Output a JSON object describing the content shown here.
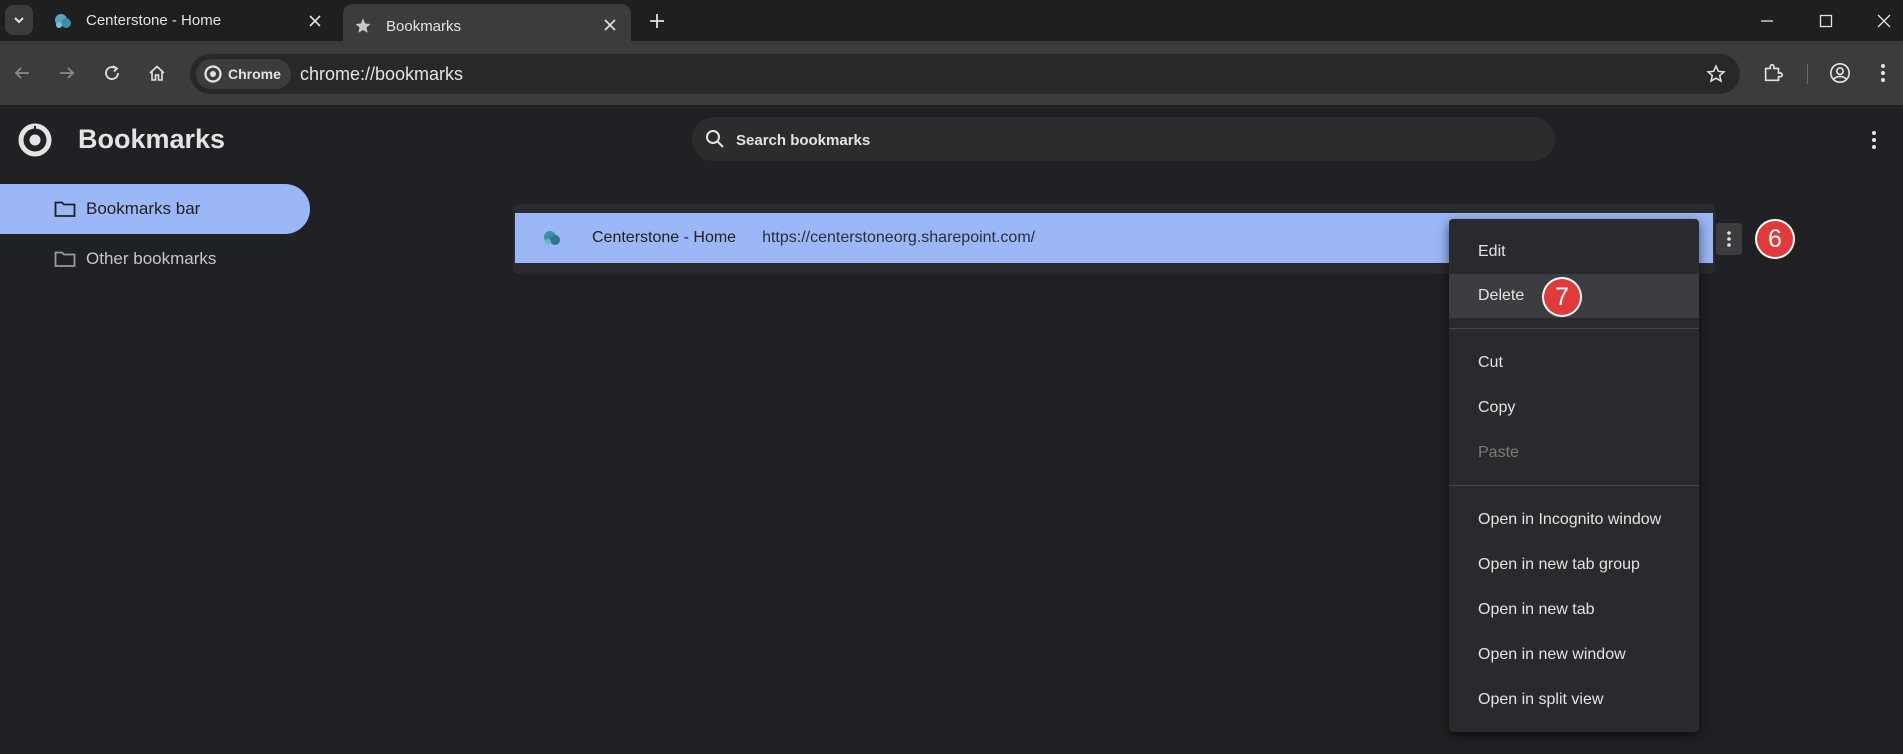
{
  "browser": {
    "tabs": [
      {
        "title": "Centerstone - Home",
        "active": false
      },
      {
        "title": "Bookmarks",
        "active": true
      }
    ],
    "chip_label": "Chrome",
    "url": "chrome://bookmarks"
  },
  "page": {
    "title": "Bookmarks",
    "search_placeholder": "Search bookmarks"
  },
  "sidebar": {
    "items": [
      {
        "label": "Bookmarks bar",
        "selected": true
      },
      {
        "label": "Other bookmarks",
        "selected": false
      }
    ]
  },
  "bookmarks": [
    {
      "title": "Centerstone - Home",
      "url": "https://centerstoneorg.sharepoint.com/"
    }
  ],
  "annotations": {
    "step_menu": "6",
    "step_delete": "7"
  },
  "context_menu": {
    "items": [
      {
        "label": "Edit"
      },
      {
        "label": "Delete",
        "hovered": true
      },
      {
        "label": "Cut"
      },
      {
        "label": "Copy"
      },
      {
        "label": "Paste",
        "disabled": true
      },
      {
        "label": "Open in Incognito window"
      },
      {
        "label": "Open in new tab group"
      },
      {
        "label": "Open in new tab"
      },
      {
        "label": "Open in new window"
      },
      {
        "label": "Open in split view"
      }
    ]
  },
  "colors": {
    "accent": "#9bb7f6",
    "badge": "#e03a3a",
    "page_bg": "#202124"
  }
}
